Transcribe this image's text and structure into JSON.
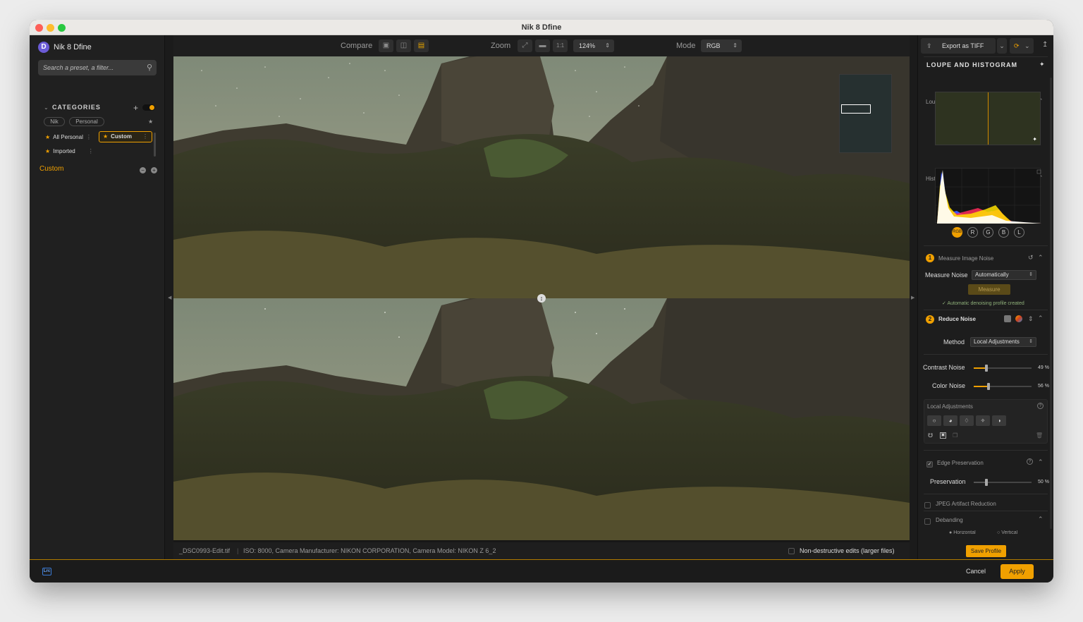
{
  "window": {
    "title": "Nik 8 Dfine"
  },
  "app": {
    "name": "Nik 8 Dfine",
    "logo_letter": "D"
  },
  "sidebar": {
    "search_placeholder": "Search a preset, a filter...",
    "categories_label": "CATEGORIES",
    "filters": [
      "Nik",
      "Personal"
    ],
    "presets": [
      {
        "label": "All Personal"
      },
      {
        "label": "Custom",
        "selected": true
      },
      {
        "label": "Imported"
      }
    ],
    "custom_title": "Custom"
  },
  "toolbar": {
    "compare_label": "Compare",
    "zoom_label": "Zoom",
    "zoom_one_to_one": "1:1",
    "zoom_value": "124%",
    "mode_label": "Mode",
    "mode_value": "RGB"
  },
  "status": {
    "filename": "_DSC0993-Edit.tif",
    "exif": "ISO: 8000, Camera Manufacturer: NIKON CORPORATION, Camera Model: NIKON Z 6_2",
    "nondestructive_label": "Non-destructive edits (larger files)"
  },
  "right_panel": {
    "export_label": "Export as TIFF",
    "loupe_histogram_title": "LOUPE AND HISTOGRAM",
    "loupe_label": "Loupe",
    "histogram_label": "Histogram",
    "channels": [
      "RGB",
      "R",
      "G",
      "B",
      "L"
    ],
    "step1": {
      "num": "1",
      "title": "Measure Image Noise",
      "measure_noise_label": "Measure Noise",
      "measure_noise_value": "Automatically",
      "measure_button": "Measure",
      "status": "Automatic denoising profile created"
    },
    "step2": {
      "num": "2",
      "title": "Reduce Noise",
      "method_label": "Method",
      "method_value": "Local Adjustments"
    },
    "sliders": [
      {
        "label": "Contrast Noise",
        "value": 49,
        "display": "49 %"
      },
      {
        "label": "Color Noise",
        "value": 56,
        "display": "56 %"
      }
    ],
    "local_adjustments_label": "Local Adjustments",
    "edge_preservation": {
      "label": "Edge Preservation",
      "checked": true,
      "slider_label": "Preservation",
      "value": 50,
      "display": "50 %"
    },
    "jpeg_label": "JPEG Artifact Reduction",
    "debanding_label": "Debanding",
    "debanding_options": [
      "Horizontal",
      "Vertical"
    ],
    "save_profile_label": "Save Profile"
  },
  "bottom": {
    "cancel_label": "Cancel",
    "apply_label": "Apply",
    "lrc_badge": "Lrc"
  },
  "colors": {
    "accent": "#f0a000",
    "panel": "#1d1d1d",
    "background": "#171717"
  }
}
